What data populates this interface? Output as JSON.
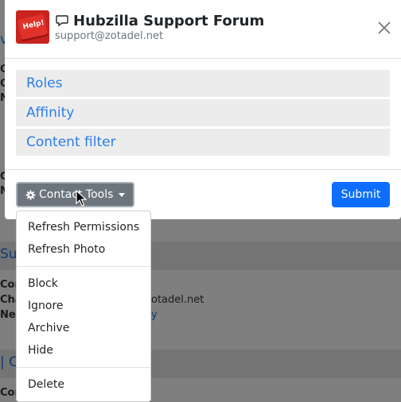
{
  "background": {
    "fragments": [
      {
        "text": "v"
      },
      {
        "text": "Co"
      },
      {
        "text": "Ch"
      },
      {
        "text": "Ne"
      },
      {
        "text": "Co"
      },
      {
        "text": "Ne"
      },
      {
        "text": "Su"
      },
      {
        "text": "Con"
      },
      {
        "text": "Cha"
      },
      {
        "text": "otadel.net"
      },
      {
        "text": "Net"
      },
      {
        "text": "y"
      },
      {
        "text": "| C"
      },
      {
        "text": "Con"
      }
    ]
  },
  "modal": {
    "title": "Hubzilla Support Forum",
    "address": "support@zotadel.net",
    "avatar_text": "Help!",
    "sections": [
      {
        "label": "Roles"
      },
      {
        "label": "Affinity"
      },
      {
        "label": "Content filter"
      }
    ],
    "footer": {
      "tools_label": "Contact Tools",
      "submit_label": "Submit"
    }
  },
  "dropdown": {
    "items": [
      {
        "label": "Refresh Permissions"
      },
      {
        "label": "Refresh Photo"
      },
      {
        "label": "Block"
      },
      {
        "label": "Ignore"
      },
      {
        "label": "Archive"
      },
      {
        "label": "Hide"
      },
      {
        "label": "Delete"
      }
    ]
  },
  "colors": {
    "link": "#2b7de9",
    "primary": "#0d6efd",
    "secondary": "#6c757d",
    "section_bg": "#ececec"
  },
  "icons": [
    "chat-icon",
    "close-icon",
    "gear-icon",
    "caret-down-icon",
    "mouse-cursor-icon"
  ]
}
